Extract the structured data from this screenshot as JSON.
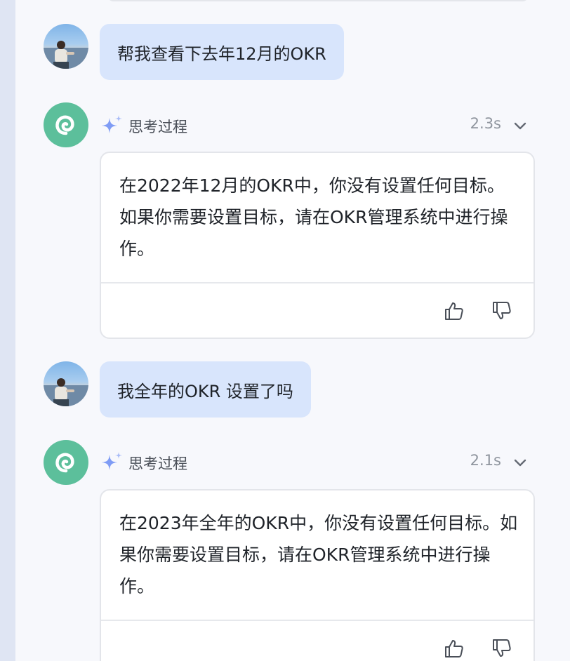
{
  "conversation": {
    "messages": [
      {
        "role": "user",
        "avatar_icon": "user-photo-avatar",
        "text": "帮我查看下去年12月的OKR"
      },
      {
        "role": "assistant",
        "avatar_icon": "snail-spiral-logo",
        "thinking_label": "思考过程",
        "thinking_time": "2.3s",
        "answer": "在2022年12月的OKR中，你没有设置任何目标。如果你需要设置目标，请在OKR管理系统中进行操作。",
        "feedback": {
          "like_icon": "thumbs-up-icon",
          "dislike_icon": "thumbs-down-icon"
        }
      },
      {
        "role": "user",
        "avatar_icon": "user-photo-avatar",
        "text": "我全年的OKR 设置了吗"
      },
      {
        "role": "assistant",
        "avatar_icon": "snail-spiral-logo",
        "thinking_label": "思考过程",
        "thinking_time": "2.1s",
        "answer": "在2023年全年的OKR中，你没有设置任何目标。如果你需要设置目标，请在OKR管理系统中进行操作。",
        "feedback": {
          "like_icon": "thumbs-up-icon",
          "dislike_icon": "thumbs-down-icon"
        }
      }
    ]
  },
  "colors": {
    "background": "#f7f8fc",
    "user_bubble": "#d8e5fc",
    "bot_avatar": "#5cbf9b",
    "sparkle": "#7f9cf5",
    "card_border": "#e3e5ea"
  }
}
